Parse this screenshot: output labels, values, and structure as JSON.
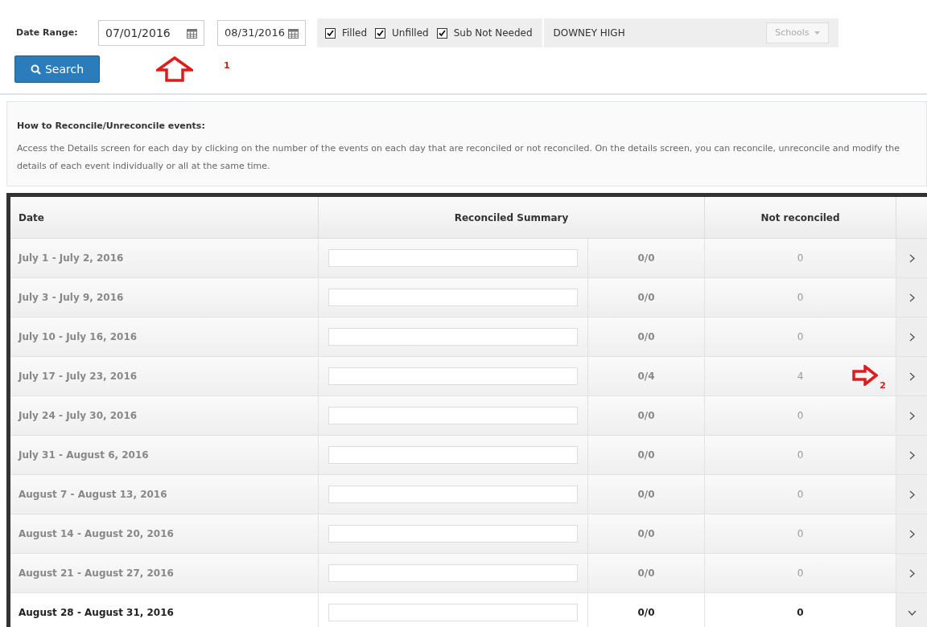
{
  "filters": {
    "label": "Date Range:",
    "start_date": "07/01/2016",
    "end_date": "08/31/2016",
    "checkboxes": [
      {
        "label": "Filled",
        "checked": true
      },
      {
        "label": "Unfilled",
        "checked": true
      },
      {
        "label": "Sub Not Needed",
        "checked": true
      }
    ],
    "school": "DOWNEY HIGH",
    "schools_button": "Schools"
  },
  "search_button": "Search",
  "annotations": [
    {
      "kind": "up",
      "number": "1"
    },
    {
      "kind": "right",
      "number": "2"
    }
  ],
  "info": {
    "title": "How to Reconcile/Unreconcile events:",
    "text": "Access the Details screen for each day by clicking on the number of the events on each day that are reconciled or not reconciled. On the details screen, you can reconcile, unreconcile and modify the details of each event individually or all at the same time."
  },
  "table": {
    "columns": [
      "Date",
      "Reconciled Summary",
      "Not reconciled"
    ],
    "rows": [
      {
        "date": "July 1 - July 2, 2016",
        "level": 0,
        "ratio": "0/0",
        "not_reconciled": "0",
        "expanded": false
      },
      {
        "date": "July 3 - July 9, 2016",
        "level": 0,
        "ratio": "0/0",
        "not_reconciled": "0",
        "expanded": false
      },
      {
        "date": "July 10 - July 16, 2016",
        "level": 0,
        "ratio": "0/0",
        "not_reconciled": "0",
        "expanded": false
      },
      {
        "date": "July 17 - July 23, 2016",
        "level": 0,
        "ratio": "0/4",
        "not_reconciled": "4",
        "expanded": false
      },
      {
        "date": "July 24 - July 30, 2016",
        "level": 0,
        "ratio": "0/0",
        "not_reconciled": "0",
        "expanded": false
      },
      {
        "date": "July 31 - August 6, 2016",
        "level": 0,
        "ratio": "0/0",
        "not_reconciled": "0",
        "expanded": false
      },
      {
        "date": "August 7 - August 13, 2016",
        "level": 0,
        "ratio": "0/0",
        "not_reconciled": "0",
        "expanded": false
      },
      {
        "date": "August 14 - August 20, 2016",
        "level": 0,
        "ratio": "0/0",
        "not_reconciled": "0",
        "expanded": false
      },
      {
        "date": "August 21 - August 27, 2016",
        "level": 0,
        "ratio": "0/0",
        "not_reconciled": "0",
        "expanded": false
      },
      {
        "date": "August 28 - August 31, 2016",
        "level": 0,
        "ratio": "0/0",
        "not_reconciled": "0",
        "expanded": true
      }
    ]
  }
}
